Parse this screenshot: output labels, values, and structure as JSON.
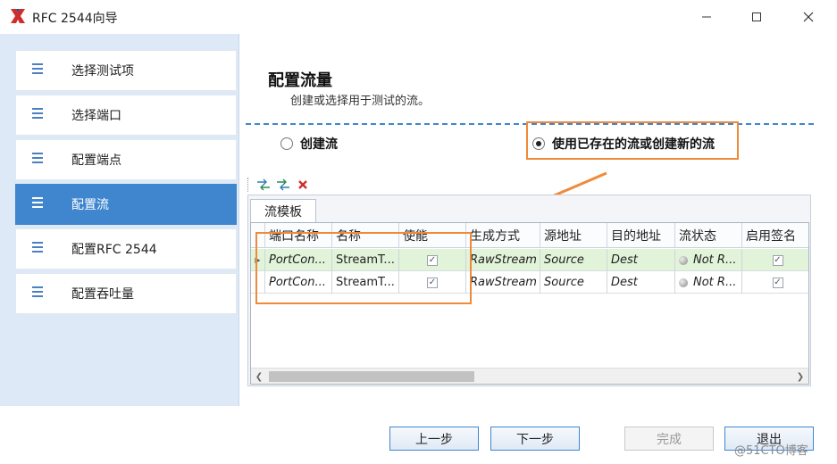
{
  "window": {
    "title": "RFC 2544向导",
    "brand_color": "#d12c2c",
    "accent_color": "#3f86cf",
    "highlight_color": "#ef8a3b"
  },
  "sidebar": {
    "items": [
      {
        "label": "选择测试项",
        "active": false
      },
      {
        "label": "选择端口",
        "active": false
      },
      {
        "label": "配置端点",
        "active": false
      },
      {
        "label": "配置流",
        "active": true
      },
      {
        "label": "配置RFC 2544",
        "active": false
      },
      {
        "label": "配置吞吐量",
        "active": false
      }
    ]
  },
  "main": {
    "title": "配置流量",
    "subtitle": "创建或选择用于测试的流。",
    "options": {
      "create_label": "创建流",
      "existing_label": "使用已存在的流或创建新的流",
      "selected": "existing"
    },
    "toolbar": {
      "icons": [
        "add-stream-icon",
        "edit-stream-icon",
        "delete-icon"
      ]
    },
    "tab_label": "流模板",
    "grid": {
      "columns": [
        "端口名称",
        "名称",
        "使能",
        "生成方式",
        "源地址",
        "目的地址",
        "流状态",
        "启用签名"
      ],
      "rows": [
        {
          "port": "PortCon...",
          "name": "StreamT...",
          "enabled": true,
          "gen": "RawStream",
          "src": "Source",
          "dst": "Dest",
          "status": "Not R...",
          "sig": true
        },
        {
          "port": "PortCon...",
          "name": "StreamT...",
          "enabled": true,
          "gen": "RawStream",
          "src": "Source",
          "dst": "Dest",
          "status": "Not R...",
          "sig": true
        }
      ]
    }
  },
  "footer": {
    "prev_label": "上一步",
    "next_label": "下一步",
    "finish_label": "完成",
    "exit_label": "退出"
  },
  "watermark": "@51CTO博客"
}
